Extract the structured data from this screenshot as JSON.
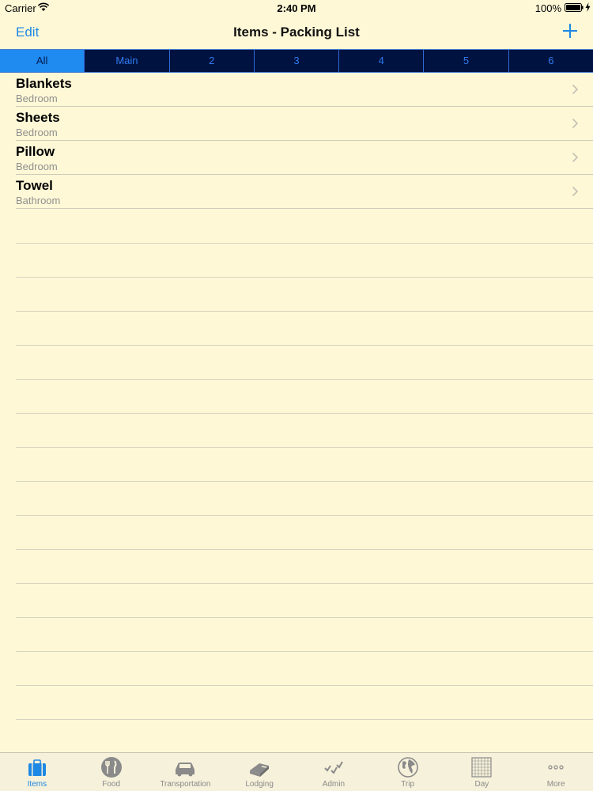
{
  "status_bar": {
    "carrier": "Carrier",
    "time": "2:40 PM",
    "battery": "100%"
  },
  "nav": {
    "edit_label": "Edit",
    "title": "Items - Packing List",
    "add_icon": "plus-icon"
  },
  "segments": [
    "All",
    "Main",
    "2",
    "3",
    "4",
    "5",
    "6"
  ],
  "selected_segment": "All",
  "items": [
    {
      "title": "Blankets",
      "subtitle": "Bedroom"
    },
    {
      "title": "Sheets",
      "subtitle": "Bedroom"
    },
    {
      "title": "Pillow",
      "subtitle": "Bedroom"
    },
    {
      "title": "Towel",
      "subtitle": "Bathroom"
    }
  ],
  "tabs": [
    {
      "label": "Items",
      "icon": "suitcase-icon"
    },
    {
      "label": "Food",
      "icon": "fork-knife-icon"
    },
    {
      "label": "Transportation",
      "icon": "car-icon"
    },
    {
      "label": "Lodging",
      "icon": "bed-icon"
    },
    {
      "label": "Admin",
      "icon": "checkmarks-icon"
    },
    {
      "label": "Trip",
      "icon": "globe-icon"
    },
    {
      "label": "Day",
      "icon": "calendar-icon"
    },
    {
      "label": "More",
      "icon": "more-icon"
    }
  ],
  "selected_tab": "Items",
  "colors": {
    "accent": "#1e88e5",
    "background": "#fff8d6",
    "segment_bg": "#00123f",
    "segment_active": "#1f8af0"
  }
}
